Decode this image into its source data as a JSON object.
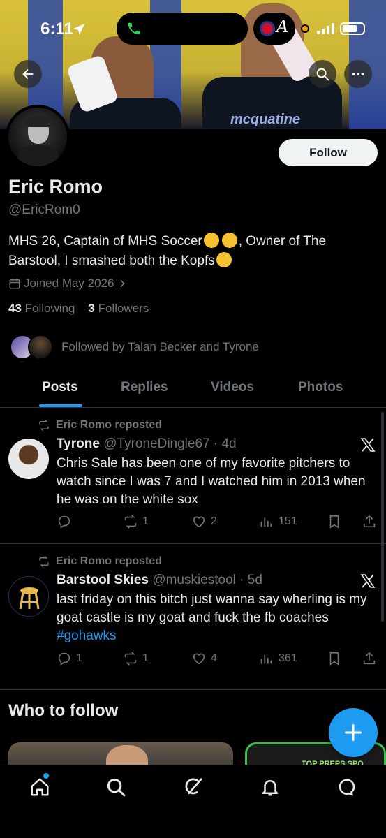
{
  "status_bar": {
    "time": "6:11"
  },
  "profile": {
    "name": "Eric Romo",
    "handle": "@EricRom0",
    "bio_part1": "MHS 26, Captain of MHS Soccer",
    "bio_part2": ", Owner of The Barstool, I smashed both the Kopfs",
    "joined": "Joined May 2026",
    "following_count": "43",
    "following_label": "Following",
    "followers_count": "3",
    "followers_label": "Followers",
    "followed_by": "Followed by Talan Becker and Tyrone",
    "follow_button": "Follow",
    "banner_jersey_text": "mcquatine"
  },
  "tabs": [
    "Posts",
    "Replies",
    "Videos",
    "Photos"
  ],
  "posts": [
    {
      "repost_label": "Eric Romo reposted",
      "author": "Tyrone",
      "meta": "@TyroneDingle67 · 4d",
      "text": "Chris Sale has been one of my favorite pitchers to watch since I was 7 and I watched him in 2013 when he was on the white sox",
      "hashtag": "",
      "replies": "",
      "reposts": "1",
      "likes": "2",
      "views": "151"
    },
    {
      "repost_label": "Eric Romo reposted",
      "author": "Barstool Skies",
      "meta": "@muskiestool · 5d",
      "text": "last friday on this bitch just wanna say wherling is my goat castle is my goat and fuck the fb coaches",
      "hashtag": "#gohawks",
      "replies": "1",
      "reposts": "1",
      "likes": "4",
      "views": "361"
    }
  ],
  "who_to_follow": "Who to follow",
  "card_text": "TOP PREPS SPO",
  "icons": {
    "back": "arrow-left-icon",
    "search": "search-icon",
    "more": "more-icon",
    "nav": [
      "home-icon",
      "search-icon",
      "grok-icon",
      "notifications-icon",
      "messages-icon"
    ]
  },
  "colors": {
    "accent": "#1d9bf0",
    "text": "#e7e9ea",
    "muted": "#71767b",
    "background": "#000000"
  }
}
